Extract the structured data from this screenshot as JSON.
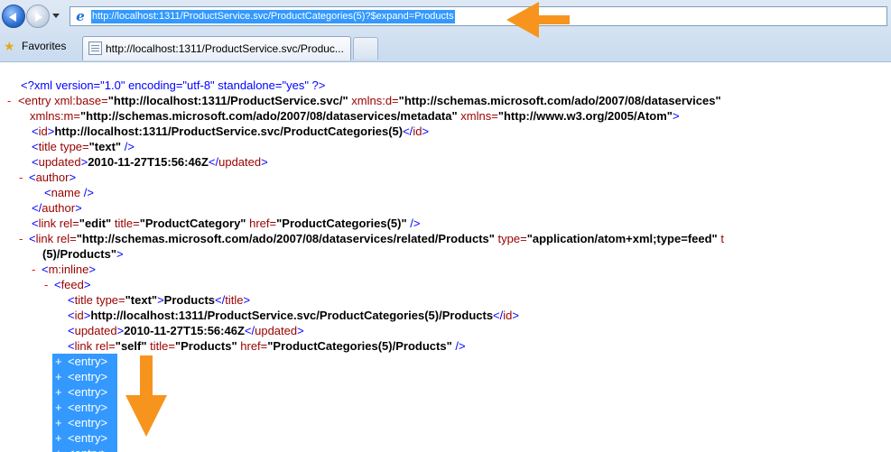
{
  "browser": {
    "url": "http://localhost:1311/ProductService.svc/ProductCategories(5)?$expand=Products",
    "favorites_label": "Favorites",
    "tab_title": "http://localhost:1311/ProductService.svc/Produc..."
  },
  "xml": {
    "pi": "<?xml version=\"1.0\" encoding=\"utf-8\" standalone=\"yes\" ?>",
    "entry_open": "<entry",
    "xml_base_attr": "xml:base=",
    "xml_base_val": "\"http://localhost:1311/ProductService.svc/\"",
    "xmlns_d_attr": "xmlns:d=",
    "xmlns_d_val": "\"http://schemas.microsoft.com/ado/2007/08/dataservices\"",
    "xmlns_m_attr": "xmlns:m=",
    "xmlns_m_val": "\"http://schemas.microsoft.com/ado/2007/08/dataservices/metadata\"",
    "xmlns_attr": "xmlns=",
    "xmlns_val": "\"http://www.w3.org/2005/Atom\"",
    "id_text": "http://localhost:1311/ProductService.svc/ProductCategories(5)",
    "title_type_val": "\"text\"",
    "updated_text": "2010-11-27T15:56:46Z",
    "author_tag": "author",
    "name_tag": "name",
    "link_edit_rel": "\"edit\"",
    "link_edit_title": "\"ProductCategory\"",
    "link_edit_href": "\"ProductCategories(5)\"",
    "link_related_rel": "\"http://schemas.microsoft.com/ado/2007/08/dataservices/related/Products\"",
    "link_related_type": "\"application/atom+xml;type=feed\"",
    "link_related_trail": "t",
    "link_related_cont": "(5)/Products\"",
    "m_inline_tag": "m:inline",
    "feed_tag": "feed",
    "feed_title_text": "Products",
    "feed_id_text": "http://localhost:1311/ProductService.svc/ProductCategories(5)/Products",
    "feed_updated_text": "2010-11-27T15:56:46Z",
    "link_self_rel": "\"self\"",
    "link_self_title": "\"Products\"",
    "link_self_href": "\"ProductCategories(5)/Products\"",
    "collapsed_entry": "<entry>",
    "collapsed_count": 7
  },
  "colors": {
    "tag": "#990000",
    "bracket": "#0000ff",
    "selection": "#3399ff",
    "annotation_arrow": "#f7941d"
  }
}
